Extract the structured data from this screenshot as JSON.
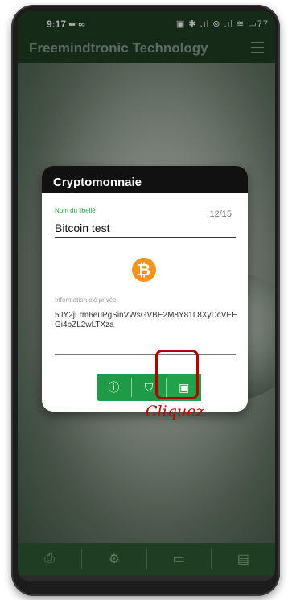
{
  "statusbar": {
    "time": "9:17",
    "time_icons": "▪▪ ∞",
    "right_icons": "▣ ✱ .ıl ⊚ .ıl ≋ ▭77"
  },
  "appbar": {
    "title": "Freemindtronic Technology"
  },
  "dialog": {
    "title": "Cryptomonnaie",
    "name_label": "Nom du libellé",
    "name_value": "Bitcoin test",
    "counter": "12/15",
    "bitcoin_icon": "bitcoin-icon",
    "key_label": "Information clé privée",
    "key_value": "5JY2jLrm6euPgSinVWsGVBE2M8Y81L8XyDcVEEGi4bZL2wLTXza",
    "buttons": {
      "info": "ⓘ",
      "shield": "⛉",
      "save": "▣"
    }
  },
  "annotation": {
    "text": "Cliquez",
    "color": "#c40000"
  },
  "bottomnav": {
    "items": [
      "printer-icon",
      "gear-icon",
      "devices-icon",
      "document-search-icon"
    ]
  },
  "colors": {
    "accent": "#1f9a47",
    "appbar": "#1d3a1f"
  }
}
